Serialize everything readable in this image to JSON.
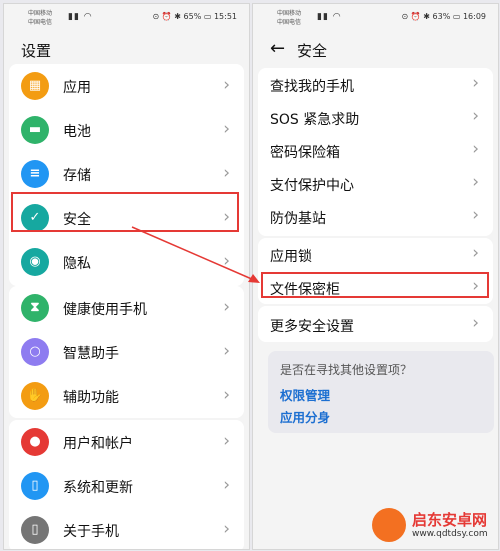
{
  "left": {
    "statusbar": {
      "carrier1": "中国移动",
      "carrier2": "中国电信",
      "right": "⊙ ⏰ ✱ 65% ▭ 15:51"
    },
    "title": "设置",
    "items": [
      {
        "label": "应用",
        "icon": "apps-icon",
        "glyph": "▦",
        "color": "#f39c12"
      },
      {
        "label": "电池",
        "icon": "battery-icon",
        "glyph": "▬",
        "color": "#2fb36a"
      },
      {
        "label": "存储",
        "icon": "storage-icon",
        "glyph": "≡",
        "color": "#2196f3"
      },
      {
        "label": "安全",
        "icon": "shield-icon",
        "glyph": "✓",
        "color": "#16a8a0"
      },
      {
        "label": "隐私",
        "icon": "privacy-icon",
        "glyph": "◉",
        "color": "#16a8a0"
      },
      {
        "label": "健康使用手机",
        "icon": "hourglass-icon",
        "glyph": "⧗",
        "color": "#2fb36a"
      },
      {
        "label": "智慧助手",
        "icon": "assistant-icon",
        "glyph": "○",
        "color": "#8e7cf0"
      },
      {
        "label": "辅助功能",
        "icon": "hand-icon",
        "glyph": "✋",
        "color": "#f39c12"
      },
      {
        "label": "用户和帐户",
        "icon": "user-icon",
        "glyph": "●",
        "color": "#e53935"
      },
      {
        "label": "系统和更新",
        "icon": "system-icon",
        "glyph": "▯",
        "color": "#2196f3"
      },
      {
        "label": "关于手机",
        "icon": "phone-icon",
        "glyph": "▯",
        "color": "#757575"
      }
    ]
  },
  "right": {
    "statusbar": {
      "carrier1": "中国移动",
      "carrier2": "中国电信",
      "right": "⊙ ⏰ ✱ 63% ▭ 16:09"
    },
    "back": "←",
    "title": "安全",
    "group1": [
      "查找我的手机",
      "SOS 紧急求助",
      "密码保险箱",
      "支付保护中心",
      "防伪基站"
    ],
    "group2": [
      "应用锁",
      "文件保密柜"
    ],
    "group3": [
      "更多安全设置"
    ],
    "suggest": {
      "question": "是否在寻找其他设置项？",
      "links": [
        "权限管理",
        "应用分身"
      ]
    }
  },
  "chevron": "›",
  "watermark": {
    "name": "启东安卓网",
    "url": "www.qdtdsy.com"
  },
  "colors": {
    "highlight": "#e53935",
    "link": "#1c6fd1"
  }
}
